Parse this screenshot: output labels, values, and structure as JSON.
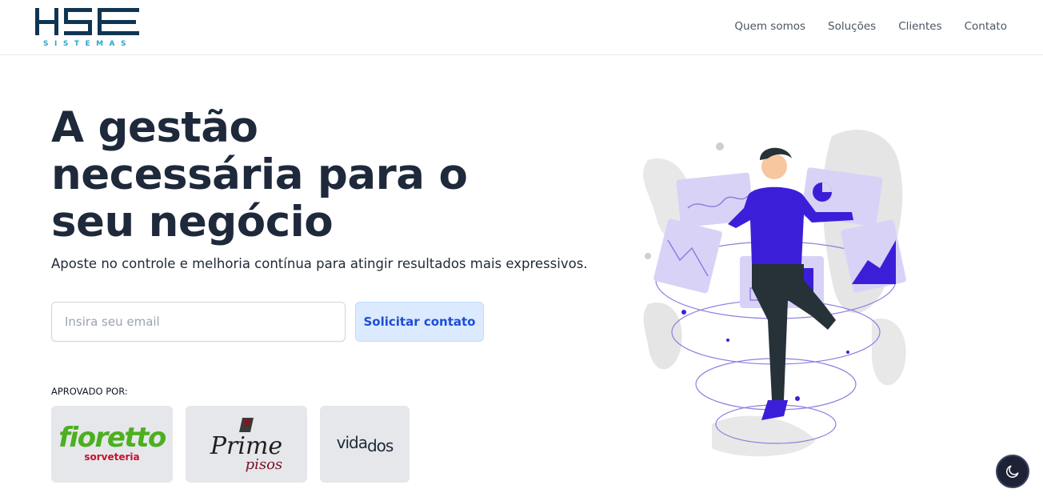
{
  "brand": {
    "logo_text": "HSE",
    "logo_subtext": "SISTEMAS",
    "logo_color": "#0f3552",
    "logo_accent": "#2aa7d4"
  },
  "nav": {
    "items": [
      {
        "label": "Quem somos"
      },
      {
        "label": "Soluções"
      },
      {
        "label": "Clientes"
      },
      {
        "label": "Contato"
      }
    ]
  },
  "hero": {
    "title": "A gestão necessária para o seu negócio",
    "subtitle": "Aposte no controle e melhoria contínua para atingir resultados mais expressivos.",
    "email_placeholder": "Insira seu email",
    "email_value": "",
    "cta_label": "Solicitar contato"
  },
  "clients": {
    "label": "APROVADO POR:",
    "items": [
      {
        "name": "fioretto",
        "subtitle": "sorveteria"
      },
      {
        "name": "Prime",
        "subtitle": "pisos"
      },
      {
        "name": "vida",
        "name_suffix": "dos"
      }
    ]
  },
  "theme_toggle": {
    "icon": "moon-icon"
  },
  "colors": {
    "accent": "#1d4ed8",
    "accent_bg": "#dbeafe",
    "illustration_purple": "#3b1fd8",
    "illustration_light": "#d9d2f7"
  }
}
